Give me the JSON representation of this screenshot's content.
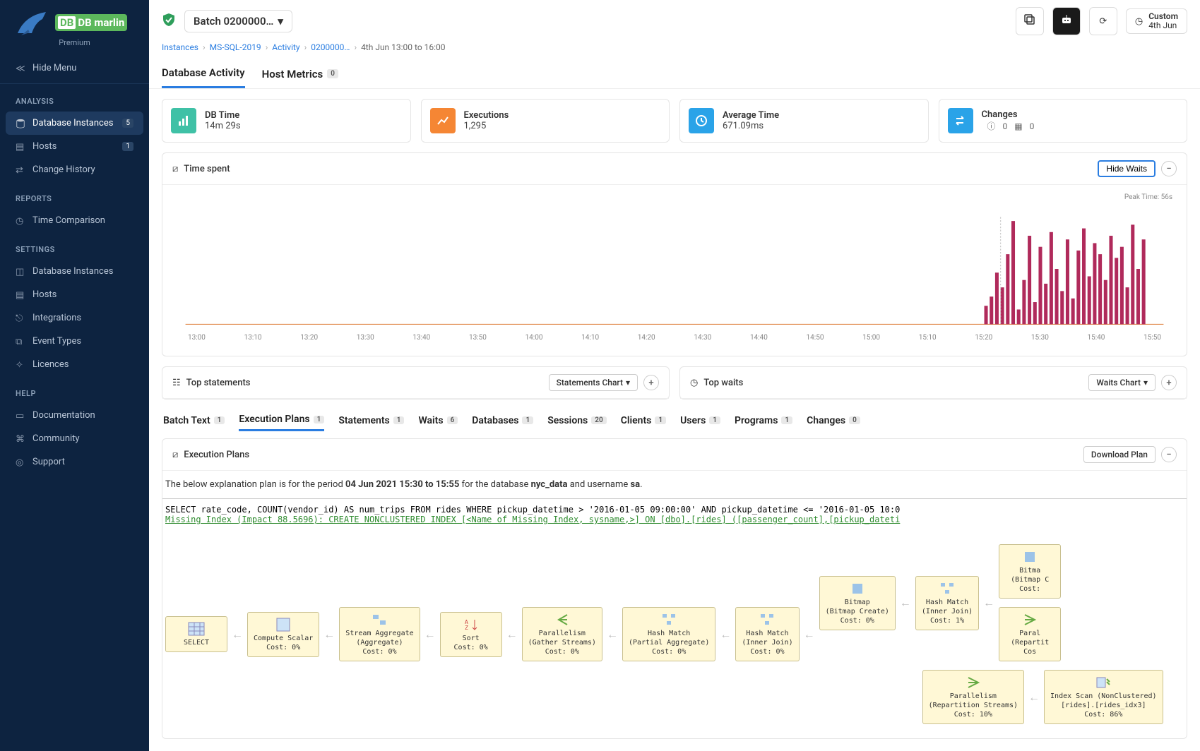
{
  "brand": {
    "name": "DB marlin",
    "tier": "Premium"
  },
  "sidebar": {
    "hide_menu": "Hide Menu",
    "sections": [
      {
        "title": "ANALYSIS",
        "items": [
          {
            "label": "Database Instances",
            "badge": "5",
            "active": true
          },
          {
            "label": "Hosts",
            "badge": "1"
          },
          {
            "label": "Change History"
          }
        ]
      },
      {
        "title": "REPORTS",
        "items": [
          {
            "label": "Time Comparison"
          }
        ]
      },
      {
        "title": "SETTINGS",
        "items": [
          {
            "label": "Database Instances"
          },
          {
            "label": "Hosts"
          },
          {
            "label": "Integrations"
          },
          {
            "label": "Event Types"
          },
          {
            "label": "Licences"
          }
        ]
      },
      {
        "title": "HELP",
        "items": [
          {
            "label": "Documentation"
          },
          {
            "label": "Community"
          },
          {
            "label": "Support"
          }
        ]
      }
    ]
  },
  "topbar": {
    "batch_label": "Batch 0200000…",
    "custom_top": "Custom",
    "custom_bottom": "4th Jun"
  },
  "breadcrumb": {
    "items": [
      "Instances",
      "MS-SQL-2019",
      "Activity",
      "0200000…"
    ],
    "current": "4th Jun 13:00 to 16:00"
  },
  "primary_tabs": [
    {
      "label": "Database Activity",
      "active": true
    },
    {
      "label": "Host Metrics",
      "badge": "0"
    }
  ],
  "stats": {
    "db_time": {
      "title": "DB Time",
      "value": "14m 29s",
      "color": "#3fc1a6"
    },
    "executions": {
      "title": "Executions",
      "value": "1,295",
      "color": "#f58634"
    },
    "avg_time": {
      "title": "Average Time",
      "value": "671.09ms",
      "color": "#2aa3e8"
    },
    "changes": {
      "title": "Changes",
      "info_count": "0",
      "cal_count": "0",
      "color": "#2aa3e8"
    }
  },
  "time_panel": {
    "title": "Time spent",
    "hide_waits": "Hide Waits",
    "peak": "Peak Time: 56s",
    "xaxis": [
      "13:00",
      "13:10",
      "13:20",
      "13:30",
      "13:40",
      "13:50",
      "14:00",
      "14:10",
      "14:20",
      "14:30",
      "14:40",
      "14:50",
      "15:00",
      "15:10",
      "15:20",
      "15:30",
      "15:40",
      "15:50"
    ]
  },
  "chart_data": {
    "type": "bar",
    "title": "Time spent",
    "xlabel": "",
    "ylabel": "",
    "ylim": [
      0,
      56
    ],
    "categories_start": "15:25",
    "values": [
      10,
      15,
      28,
      20,
      38,
      56,
      8,
      24,
      48,
      12,
      42,
      22,
      50,
      30,
      18,
      46,
      14,
      40,
      52,
      26,
      44,
      38,
      24,
      48,
      36,
      42,
      20,
      54,
      30,
      46
    ]
  },
  "top_panels": {
    "statements": {
      "title": "Top statements",
      "btn": "Statements Chart"
    },
    "waits": {
      "title": "Top waits",
      "btn": "Waits Chart"
    }
  },
  "secondary_tabs": [
    {
      "label": "Batch Text",
      "badge": "1"
    },
    {
      "label": "Execution Plans",
      "badge": "1",
      "active": true
    },
    {
      "label": "Statements",
      "badge": "1"
    },
    {
      "label": "Waits",
      "badge": "6"
    },
    {
      "label": "Databases",
      "badge": "1"
    },
    {
      "label": "Sessions",
      "badge": "20"
    },
    {
      "label": "Clients",
      "badge": "1"
    },
    {
      "label": "Users",
      "badge": "1"
    },
    {
      "label": "Programs",
      "badge": "1"
    },
    {
      "label": "Changes",
      "badge": "0"
    }
  ],
  "plan_panel": {
    "title": "Execution Plans",
    "download": "Download Plan",
    "desc_pre": "The below explanation plan is for the period ",
    "desc_period": "04 Jun 2021 15:30 to 15:55",
    "desc_mid": " for the database ",
    "desc_db": "nyc_data",
    "desc_user_pre": " and username ",
    "desc_user": "sa",
    "sql": "SELECT rate_code, COUNT(vendor_id) AS num_trips FROM rides WHERE pickup_datetime > '2016-01-05 09:00:00' AND pickup_datetime <= '2016-01-05 10:0",
    "idx": "Missing Index (Impact 88.5696): CREATE NONCLUSTERED INDEX [<Name of Missing Index, sysname,>] ON [dbo].[rides] ([passenger_count],[pickup_dateti",
    "nodes": {
      "select": {
        "l1": "SELECT",
        "l2": "",
        "l3": ""
      },
      "compute": {
        "l1": "Compute Scalar",
        "l2": "",
        "l3": "Cost: 0%"
      },
      "stream": {
        "l1": "Stream Aggregate",
        "l2": "(Aggregate)",
        "l3": "Cost: 0%"
      },
      "sort": {
        "l1": "Sort",
        "l2": "",
        "l3": "Cost: 0%"
      },
      "par1": {
        "l1": "Parallelism",
        "l2": "(Gather Streams)",
        "l3": "Cost: 0%"
      },
      "hash1": {
        "l1": "Hash Match",
        "l2": "(Partial Aggregate)",
        "l3": "Cost: 0%"
      },
      "hash2": {
        "l1": "Hash Match",
        "l2": "(Inner Join)",
        "l3": "Cost: 0%"
      },
      "bitmap1": {
        "l1": "Bitmap",
        "l2": "(Bitmap Create)",
        "l3": "Cost: 0%"
      },
      "hash3": {
        "l1": "Hash Match",
        "l2": "(Inner Join)",
        "l3": "Cost: 1%"
      },
      "bitmap2": {
        "l1": "Bitma",
        "l2": "(Bitmap C",
        "l3": "Cost:"
      },
      "par2": {
        "l1": "Paral",
        "l2": "(Repartit",
        "l3": "Cos"
      },
      "par3": {
        "l1": "Parallelism",
        "l2": "(Repartition Streams)",
        "l3": "Cost: 10%"
      },
      "scan": {
        "l1": "Index Scan (NonClustered)",
        "l2": "[rides].[rides_idx3]",
        "l3": "Cost: 86%"
      }
    }
  }
}
